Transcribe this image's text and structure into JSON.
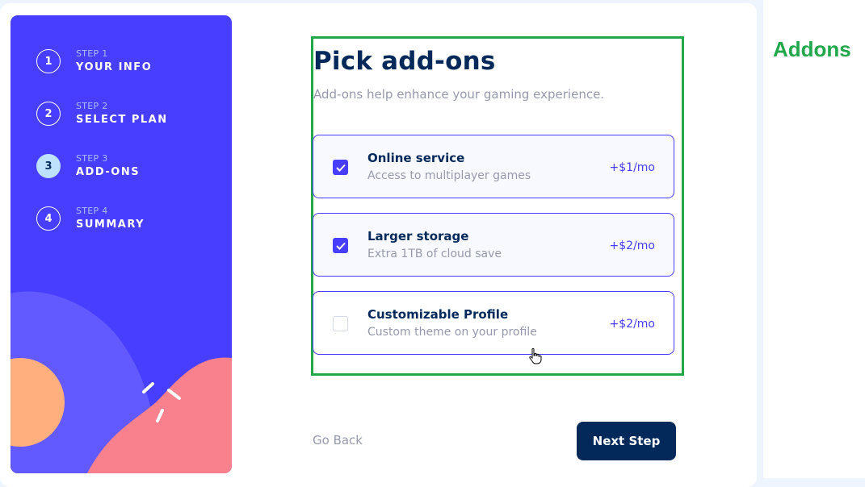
{
  "sidebar": {
    "steps": [
      {
        "number": "1",
        "small": "STEP 1",
        "label": "YOUR INFO",
        "active": false
      },
      {
        "number": "2",
        "small": "STEP 2",
        "label": "SELECT PLAN",
        "active": false
      },
      {
        "number": "3",
        "small": "STEP 3",
        "label": "ADD-ONS",
        "active": true
      },
      {
        "number": "4",
        "small": "STEP 4",
        "label": "SUMMARY",
        "active": false
      }
    ]
  },
  "main": {
    "title": "Pick add-ons",
    "subtitle": "Add-ons help enhance your gaming experience.",
    "addons": [
      {
        "name": "Online service",
        "description": "Access to multiplayer games",
        "price": "+$1/mo",
        "checked": true
      },
      {
        "name": "Larger storage",
        "description": "Extra 1TB of cloud save",
        "price": "+$2/mo",
        "checked": true
      },
      {
        "name": "Customizable Profile",
        "description": "Custom theme on your profile",
        "price": "+$2/mo",
        "checked": false
      }
    ],
    "back_label": "Go Back",
    "next_label": "Next Step"
  },
  "annotation": {
    "label": "Addons"
  },
  "colors": {
    "sidebar_bg": "#483eff",
    "primary_dark": "#02295a",
    "accent": "#483eff",
    "highlight": "#22a84a",
    "muted_text": "#9699ab"
  }
}
